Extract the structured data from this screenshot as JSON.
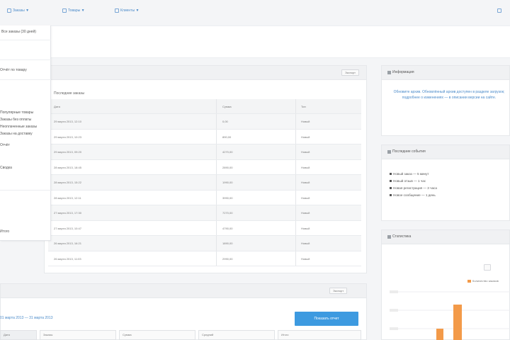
{
  "topbar": {
    "links": [
      "Заказы ▼",
      "Товары ▼",
      "Клиенты ▼"
    ]
  },
  "menu": {
    "items": [
      "Все заказы (30 дней)",
      "",
      "Отчёт по товару",
      "Популярные товары",
      "Заказы без оплаты",
      "Неоплаченные заказы",
      "Заказы на доставку",
      "Отчёт",
      "Сводка",
      "Итого"
    ]
  },
  "orders_panel": {
    "button": "Экспорт",
    "caption": "Последние заказы",
    "columns": [
      "Дата",
      "Сумма",
      "Тип"
    ],
    "rows": [
      [
        "29 марта 2013, 12:10",
        "0,00",
        "Новый"
      ],
      [
        "29 марта 2013, 10:23",
        "890,00",
        "Новый"
      ],
      [
        "29 марта 2013, 09:20",
        "4270,00",
        "Новый"
      ],
      [
        "28 марта 2013, 18:45",
        "2890,00",
        "Новый"
      ],
      [
        "28 марта 2013, 15:22",
        "1990,00",
        "Новый"
      ],
      [
        "28 марта 2013, 12:11",
        "3990,00",
        "Новый"
      ],
      [
        "27 марта 2013, 17:30",
        "7270,00",
        "Новый"
      ],
      [
        "27 марта 2013, 10:47",
        "4790,00",
        "Новый"
      ],
      [
        "26 марта 2013, 16:21",
        "1890,00",
        "Новый"
      ],
      [
        "26 марта 2013, 11:03",
        "2990,00",
        "Новый"
      ]
    ]
  },
  "messages_panel": {
    "title": "Информация",
    "text": "Обновите архив. Обновлённый архив доступен в разделе загрузок; подробнее о изменениях — в описании версии на сайте."
  },
  "events_panel": {
    "title": "Последние события",
    "items": [
      "Новый заказ — 5 минут",
      "Новый отзыв — 1 час",
      "Новая регистрация — 3 часа",
      "Новое сообщение — 1 день"
    ]
  },
  "stats_panel": {
    "title": "Статистика",
    "legend": "Количество заказов"
  },
  "bottom_panel": {
    "button": "Экспорт",
    "date_links": "01 марта 2013 — 31 марта 2013",
    "main_button": "Показать отчет",
    "columns": [
      "Дата",
      "Заказы",
      "Сумма",
      "Средний",
      "Итого"
    ]
  }
}
